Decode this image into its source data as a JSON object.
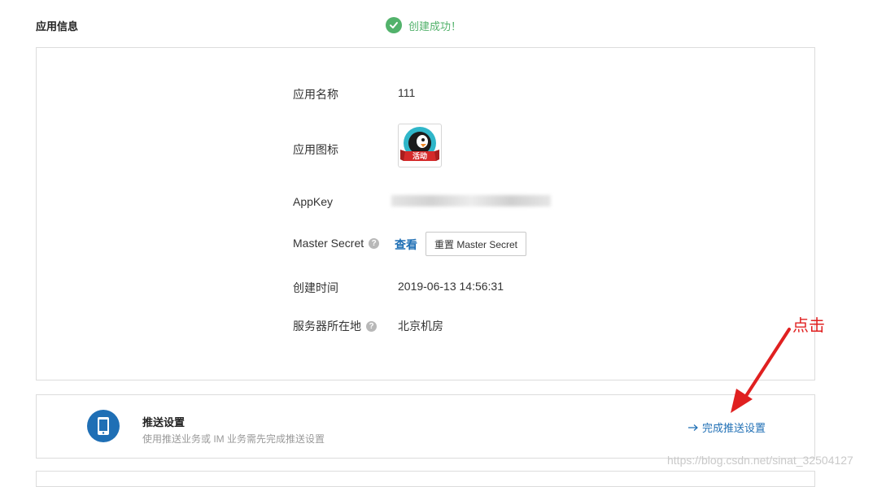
{
  "header": {
    "title": "应用信息",
    "status": "创建成功！"
  },
  "info": {
    "name_label": "应用名称",
    "name_value": "111",
    "icon_label": "应用图标",
    "icon_badge": "活动",
    "appkey_label": "AppKey",
    "secret_label": "Master Secret",
    "secret_view": "查看",
    "secret_reset": "重置 Master Secret",
    "created_label": "创建时间",
    "created_value": "2019-06-13 14:56:31",
    "server_label": "服务器所在地",
    "server_value": "北京机房"
  },
  "push": {
    "title": "推送设置",
    "desc": "使用推送业务或 IM 业务需先完成推送设置",
    "action": "完成推送设置"
  },
  "annotation": {
    "text": "点击"
  },
  "watermark": "https://blog.csdn.net/sinat_32504127",
  "colors": {
    "success": "#52b26b",
    "link": "#1f6fb5",
    "annotation": "#e02020"
  }
}
